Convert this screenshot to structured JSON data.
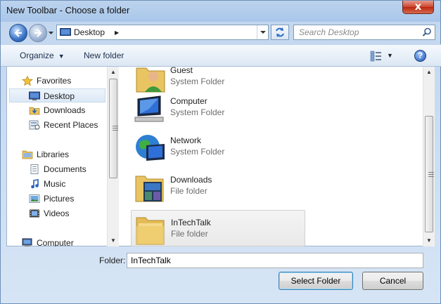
{
  "window": {
    "title": "New Toolbar - Choose a folder",
    "close_glyph": "x"
  },
  "nav": {
    "address": "Desktop",
    "search_placeholder": "Search Desktop"
  },
  "toolbar": {
    "organize": "Organize",
    "new_folder": "New folder"
  },
  "sidebar": {
    "items": [
      {
        "label": "Favorites",
        "icon": "star-icon"
      },
      {
        "label": "Desktop",
        "icon": "desktop-icon",
        "selected": true
      },
      {
        "label": "Downloads",
        "icon": "downloads-icon"
      },
      {
        "label": "Recent Places",
        "icon": "recent-places-icon"
      },
      {
        "label": "Libraries",
        "icon": "libraries-icon"
      },
      {
        "label": "Documents",
        "icon": "documents-icon"
      },
      {
        "label": "Music",
        "icon": "music-icon"
      },
      {
        "label": "Pictures",
        "icon": "pictures-icon"
      },
      {
        "label": "Videos",
        "icon": "videos-icon"
      },
      {
        "label": "Computer",
        "icon": "computer-icon"
      }
    ]
  },
  "files": [
    {
      "name": "Guest",
      "type": "System Folder",
      "icon": "user-folder-icon"
    },
    {
      "name": "Computer",
      "type": "System Folder",
      "icon": "computer-icon"
    },
    {
      "name": "Network",
      "type": "System Folder",
      "icon": "network-icon"
    },
    {
      "name": "Downloads",
      "type": "File folder",
      "icon": "downloads-folder-icon"
    },
    {
      "name": "InTechTalk",
      "type": "File folder",
      "icon": "folder-icon",
      "selected": true
    }
  ],
  "footer": {
    "folder_label": "Folder:",
    "folder_value": "InTechTalk",
    "select_button": "Select Folder",
    "cancel_button": "Cancel"
  }
}
